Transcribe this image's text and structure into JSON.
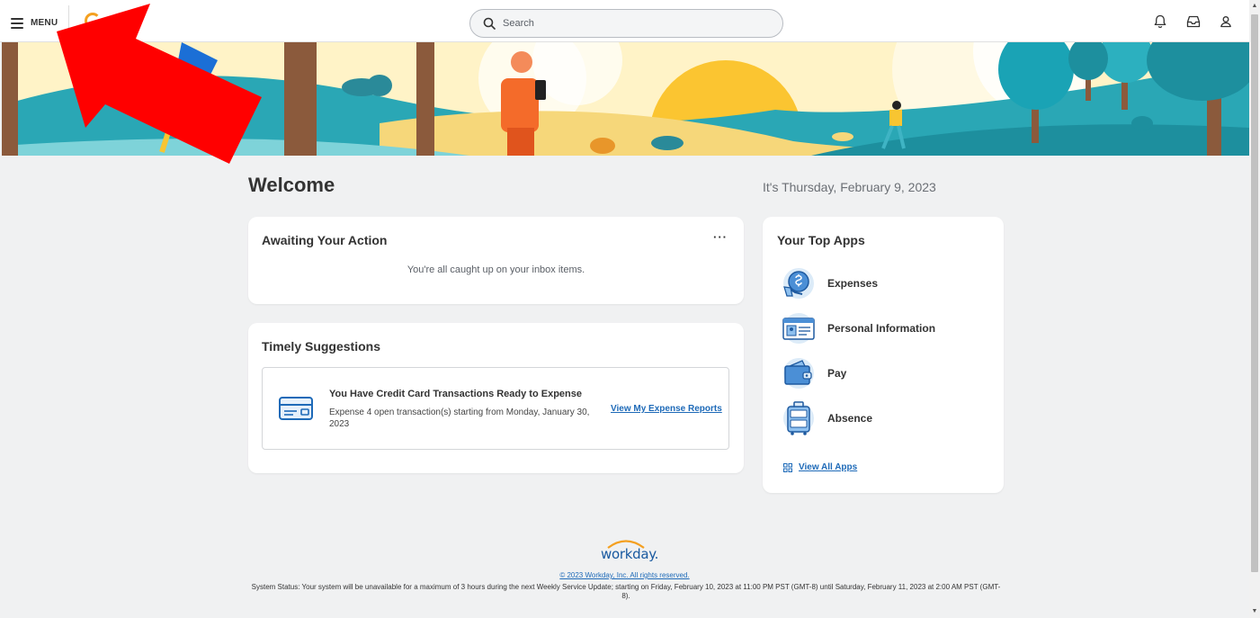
{
  "header": {
    "menu_label": "MENU",
    "search_placeholder": "Search"
  },
  "main": {
    "welcome": "Welcome",
    "date_text": "It's Thursday, February 9, 2023"
  },
  "awaiting": {
    "title": "Awaiting Your Action",
    "empty_message": "You're all caught up on your inbox items.",
    "more_label": "···"
  },
  "timely": {
    "title": "Timely Suggestions",
    "suggestion": {
      "title": "You Have Credit Card Transactions Ready to Expense",
      "description": "Expense 4 open transaction(s) starting from Monday, January 30, 2023",
      "link": "View My Expense Reports"
    }
  },
  "top_apps": {
    "title": "Your Top Apps",
    "apps": [
      {
        "label": "Expenses",
        "icon": "expenses-icon"
      },
      {
        "label": "Personal Information",
        "icon": "personal-information-icon"
      },
      {
        "label": "Pay",
        "icon": "pay-wallet-icon"
      },
      {
        "label": "Absence",
        "icon": "absence-luggage-icon"
      }
    ],
    "view_all": "View All Apps"
  },
  "footer": {
    "logo_text": "workday.",
    "copyright": "© 2023 Workday, Inc. All rights reserved.",
    "status": "System Status: Your system will be unavailable for a maximum of 3 hours during the next Weekly Service Update; starting on Friday, February 10, 2023 at 11:00 PM PST (GMT-8) until Saturday, February 11, 2023 at 2:00 AM PST (GMT-8)."
  },
  "colors": {
    "accent": "#1e6ab8",
    "background": "#f0f1f2",
    "banner_teal": "#1aa3b5",
    "banner_sun": "#fbc531",
    "annotation_arrow": "#ff0000"
  }
}
